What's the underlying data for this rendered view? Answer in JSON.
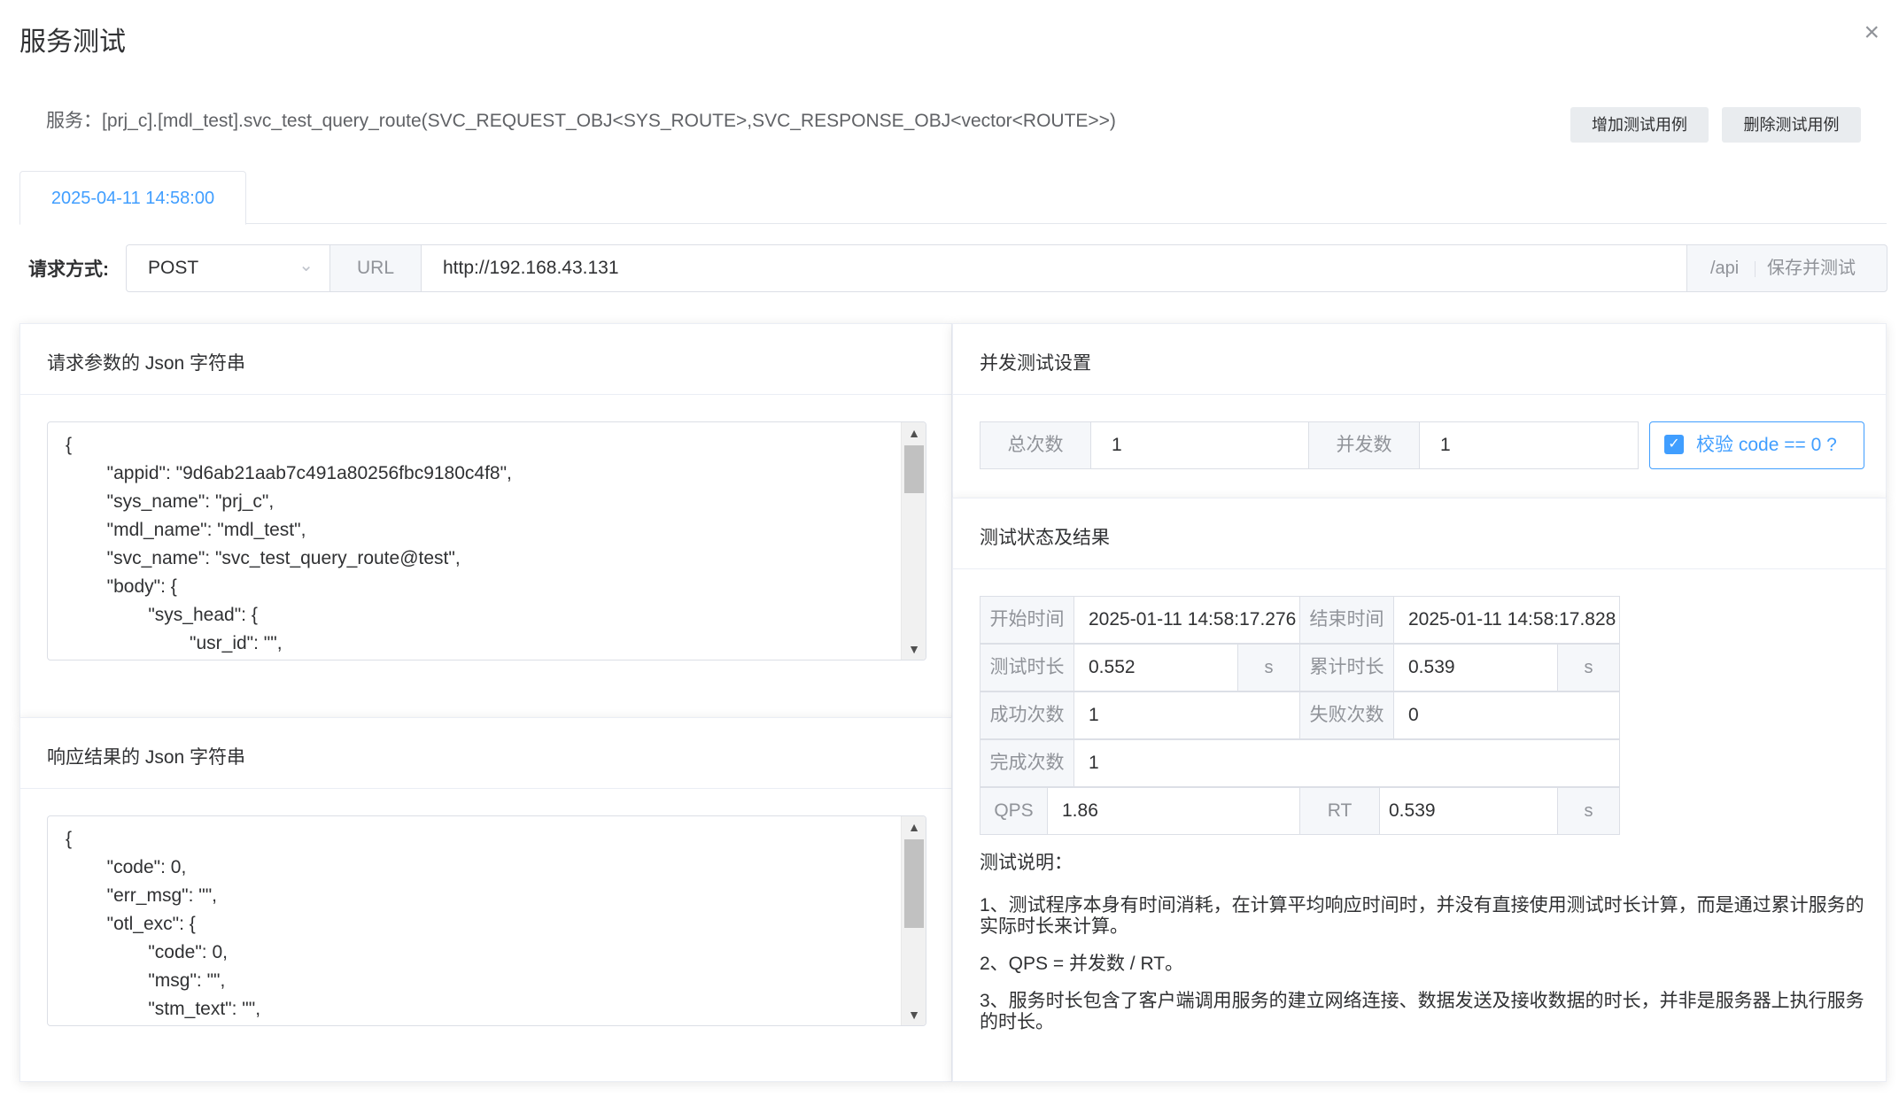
{
  "dialog": {
    "title": "服务测试",
    "close": "×"
  },
  "service": {
    "text": "服务：[prj_c].[mdl_test].svc_test_query_route(SVC_REQUEST_OBJ<SYS_ROUTE>,SVC_RESPONSE_OBJ<vector<ROUTE>>)"
  },
  "toolbar": {
    "add_label": "增加测试用例",
    "delete_label": "删除测试用例"
  },
  "tabs": [
    {
      "label": "2025-04-11 14:58:00",
      "active": true
    }
  ],
  "request": {
    "method_label": "请求方式:",
    "method_value": "POST",
    "url_label": "URL",
    "url_value": "http://192.168.43.131",
    "url_suffix": "/api",
    "save_label": "保存并测试"
  },
  "request_json": {
    "title": "请求参数的 Json 字符串",
    "content": "{\n        \"appid\": \"9d6ab21aab7c491a80256fbc9180c4f8\",\n        \"sys_name\": \"prj_c\",\n        \"mdl_name\": \"mdl_test\",\n        \"svc_name\": \"svc_test_query_route@test\",\n        \"body\": {\n                \"sys_head\": {\n                        \"usr_id\": \"\","
  },
  "response_json": {
    "title": "响应结果的 Json 字符串",
    "content": "{\n        \"code\": 0,\n        \"err_msg\": \"\",\n        \"otl_exc\": {\n                \"code\": 0,\n                \"msg\": \"\",\n                \"stm_text\": \"\","
  },
  "concurrency": {
    "title": "并发测试设置",
    "total_label": "总次数",
    "total_value": "1",
    "concurrent_label": "并发数",
    "concurrent_value": "1",
    "check_label": "校验 code == 0 ?",
    "check_checked": true
  },
  "results": {
    "title": "测试状态及结果",
    "start_label": "开始时间",
    "start_value": "2025-01-11 14:58:17.276",
    "end_label": "结束时间",
    "end_value": "2025-01-11 14:58:17.828",
    "duration_label": "测试时长",
    "duration_value": "0.552",
    "duration_unit": "s",
    "cumulative_label": "累计时长",
    "cumulative_value": "0.539",
    "cumulative_unit": "s",
    "success_label": "成功次数",
    "success_value": "1",
    "fail_label": "失败次数",
    "fail_value": "0",
    "complete_label": "完成次数",
    "complete_value": "1",
    "qps_label": "QPS",
    "qps_value": "1.86",
    "rt_label": "RT",
    "rt_value": "0.539",
    "rt_unit": "s"
  },
  "notes": {
    "title": "测试说明：",
    "items": [
      "1、测试程序本身有时间消耗，在计算平均响应时间时，并没有直接使用测试时长计算，而是通过累计服务的实际时长来计算。",
      "2、QPS = 并发数 / RT。",
      "3、服务时长包含了客户端调用服务的建立网络连接、数据发送及接收数据的时长，并非是服务器上执行服务的时长。"
    ]
  },
  "colors": {
    "accent": "#409eff",
    "label_bg": "#f5f7fa",
    "border": "#dcdfe6"
  }
}
